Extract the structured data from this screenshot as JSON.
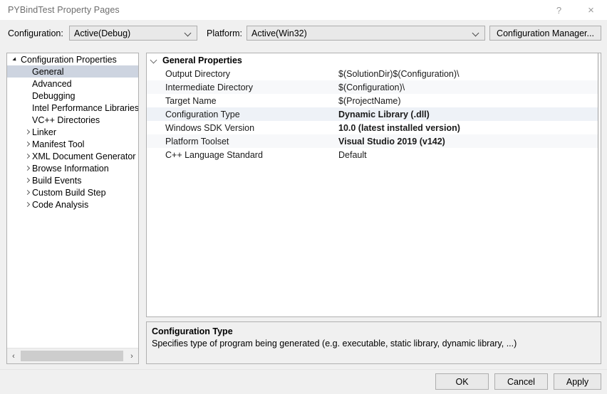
{
  "window": {
    "title": "PYBindTest Property Pages",
    "help_icon": "?",
    "close_icon": "×"
  },
  "config_bar": {
    "configuration_label": "Configuration:",
    "configuration_value": "Active(Debug)",
    "platform_label": "Platform:",
    "platform_value": "Active(Win32)",
    "config_manager_label": "Configuration Manager..."
  },
  "tree": {
    "items": [
      {
        "label": "Configuration Properties",
        "indent": 0,
        "expander": "open",
        "selected": false
      },
      {
        "label": "General",
        "indent": 1,
        "expander": "none",
        "selected": true
      },
      {
        "label": "Advanced",
        "indent": 1,
        "expander": "none",
        "selected": false
      },
      {
        "label": "Debugging",
        "indent": 1,
        "expander": "none",
        "selected": false
      },
      {
        "label": "Intel Performance Libraries",
        "indent": 1,
        "expander": "none",
        "selected": false
      },
      {
        "label": "VC++ Directories",
        "indent": 1,
        "expander": "none",
        "selected": false
      },
      {
        "label": "Linker",
        "indent": 1,
        "expander": "closed",
        "selected": false
      },
      {
        "label": "Manifest Tool",
        "indent": 1,
        "expander": "closed",
        "selected": false
      },
      {
        "label": "XML Document Generator",
        "indent": 1,
        "expander": "closed",
        "selected": false
      },
      {
        "label": "Browse Information",
        "indent": 1,
        "expander": "closed",
        "selected": false
      },
      {
        "label": "Build Events",
        "indent": 1,
        "expander": "closed",
        "selected": false
      },
      {
        "label": "Custom Build Step",
        "indent": 1,
        "expander": "closed",
        "selected": false
      },
      {
        "label": "Code Analysis",
        "indent": 1,
        "expander": "closed",
        "selected": false
      }
    ],
    "scrollbar": {
      "left_arrow": "‹",
      "right_arrow": "›"
    }
  },
  "grid": {
    "section_header": "General Properties",
    "rows": [
      {
        "name": "Output Directory",
        "value": "$(SolutionDir)$(Configuration)\\",
        "bold": false,
        "selected": false
      },
      {
        "name": "Intermediate Directory",
        "value": "$(Configuration)\\",
        "bold": false,
        "selected": false
      },
      {
        "name": "Target Name",
        "value": "$(ProjectName)",
        "bold": false,
        "selected": false
      },
      {
        "name": "Configuration Type",
        "value": "Dynamic Library (.dll)",
        "bold": true,
        "selected": true
      },
      {
        "name": "Windows SDK Version",
        "value": "10.0 (latest installed version)",
        "bold": true,
        "selected": false
      },
      {
        "name": "Platform Toolset",
        "value": "Visual Studio 2019 (v142)",
        "bold": true,
        "selected": false
      },
      {
        "name": "C++ Language Standard",
        "value": "Default",
        "bold": false,
        "selected": false
      }
    ]
  },
  "description": {
    "title": "Configuration Type",
    "text": "Specifies type of program being generated (e.g. executable, static library, dynamic library, ...)"
  },
  "footer": {
    "ok_label": "OK",
    "cancel_label": "Cancel",
    "apply_label": "Apply"
  }
}
